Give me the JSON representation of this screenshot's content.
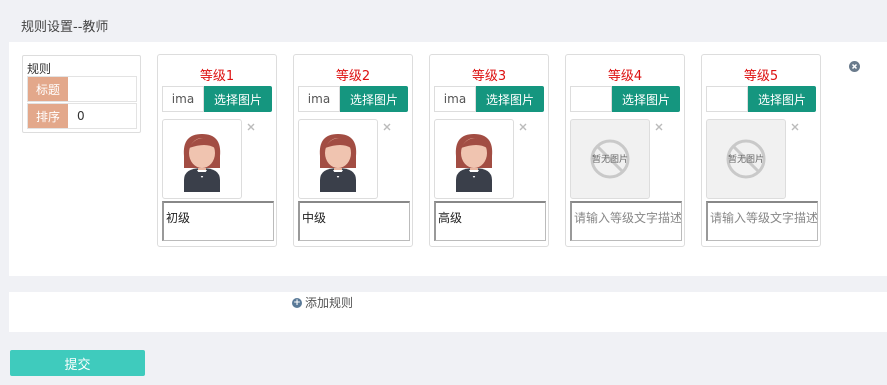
{
  "page": {
    "title": "规则设置--教师"
  },
  "rule": {
    "label": "规则",
    "fields": [
      {
        "label": "标题",
        "value": ""
      },
      {
        "label": "排序",
        "value": "0"
      }
    ]
  },
  "levels": [
    {
      "title": "等级1",
      "file_name": "ima",
      "choose_label": "选择图片",
      "image": "teacher-avatar",
      "description": "初级",
      "placeholder": ""
    },
    {
      "title": "等级2",
      "file_name": "ima",
      "choose_label": "选择图片",
      "image": "teacher-avatar",
      "description": "中级",
      "placeholder": ""
    },
    {
      "title": "等级3",
      "file_name": "ima",
      "choose_label": "选择图片",
      "image": "teacher-avatar",
      "description": "高级",
      "placeholder": ""
    },
    {
      "title": "等级4",
      "file_name": "",
      "choose_label": "选择图片",
      "image": "no-image",
      "image_text": "暂无图片",
      "description": "",
      "placeholder": "请输入等级文字描述"
    },
    {
      "title": "等级5",
      "file_name": "",
      "choose_label": "选择图片",
      "image": "no-image",
      "image_text": "暂无图片",
      "description": "",
      "placeholder": "请输入等级文字描述"
    }
  ],
  "actions": {
    "add_rule": "添加规则",
    "submit": "提交"
  },
  "colors": {
    "accent": "#15967f",
    "submit": "#3fcbbd",
    "level_title": "#dd1111",
    "label_bg": "#e3a88b"
  }
}
